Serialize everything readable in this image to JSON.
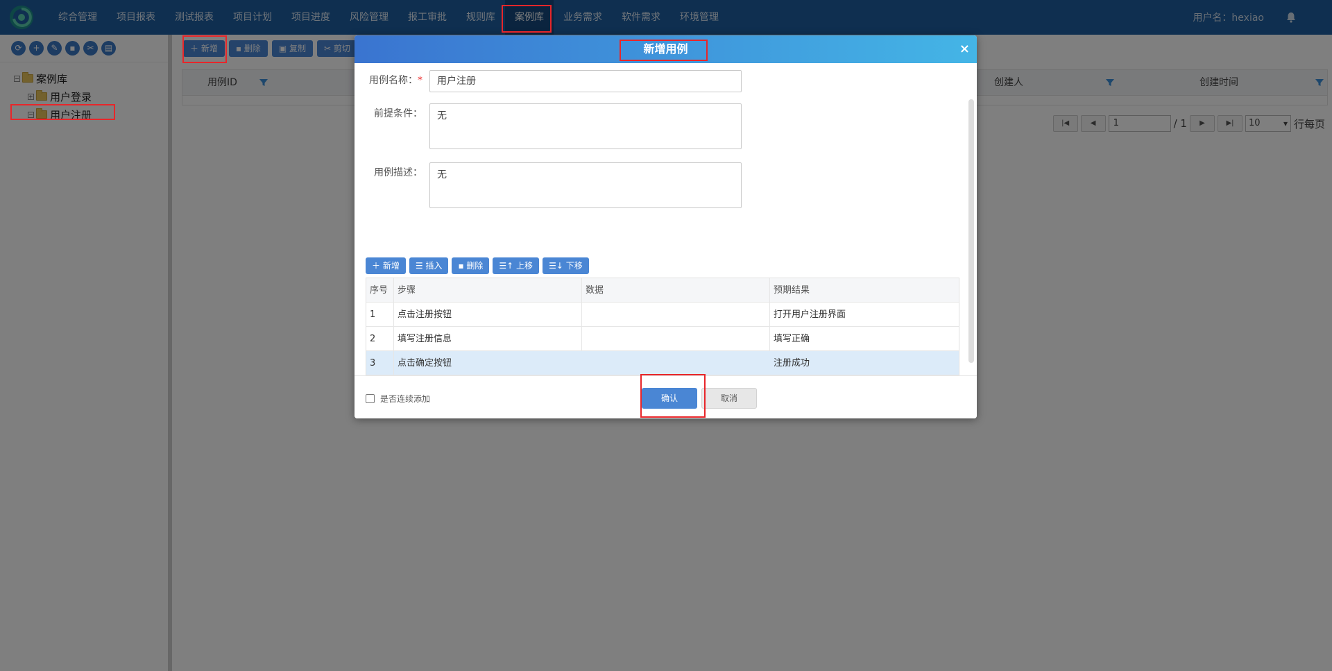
{
  "nav": {
    "items": [
      "综合管理",
      "项目报表",
      "测试报表",
      "项目计划",
      "项目进度",
      "风险管理",
      "报工审批",
      "规则库",
      "案例库",
      "业务需求",
      "软件需求",
      "环境管理"
    ],
    "active_index": 8,
    "user_label": "用户名：hexiao",
    "bell_icon": "bell-icon"
  },
  "sidebar": {
    "tools": [
      "refresh-icon",
      "add-icon",
      "edit-icon",
      "delete-icon",
      "cut-icon",
      "paste-icon"
    ],
    "tree": {
      "root": "案例库",
      "children": [
        "用户登录",
        "用户注册"
      ]
    }
  },
  "main": {
    "toolbar": [
      "新增",
      "删除",
      "复制",
      "剪切"
    ],
    "grid": {
      "columns": [
        "用例ID",
        "创建人",
        "创建时间"
      ]
    },
    "pager": {
      "page": "1",
      "total": "/ 1",
      "page_size": "10",
      "per_page_label": "行每页"
    }
  },
  "dialog": {
    "title": "新增用例",
    "close": "×",
    "name_label": "用例名称：",
    "required_mark": "*",
    "name_value": "用户注册",
    "precondition_label": "前提条件：",
    "precondition_value": "无",
    "desc_label": "用例描述：",
    "desc_value": "无",
    "step_tools": [
      "新增",
      "插入",
      "删除",
      "上移",
      "下移"
    ],
    "steps": {
      "columns": [
        "序号",
        "步骤",
        "数据",
        "预期结果"
      ],
      "rows": [
        {
          "no": "1",
          "step": "点击注册按钮",
          "data": "",
          "expect": "打开用户注册界面"
        },
        {
          "no": "2",
          "step": "填写注册信息",
          "data": "",
          "expect": "填写正确"
        },
        {
          "no": "3",
          "step": "点击确定按钮",
          "data": "",
          "expect": "注册成功"
        }
      ],
      "selected_row": 2
    },
    "continuous_add_label": "是否连续添加",
    "ok_label": "确认",
    "cancel_label": "取消"
  },
  "colors": {
    "nav_bg": "#1f5fa0",
    "accent": "#4a86d4",
    "highlight": "#e8262a"
  }
}
